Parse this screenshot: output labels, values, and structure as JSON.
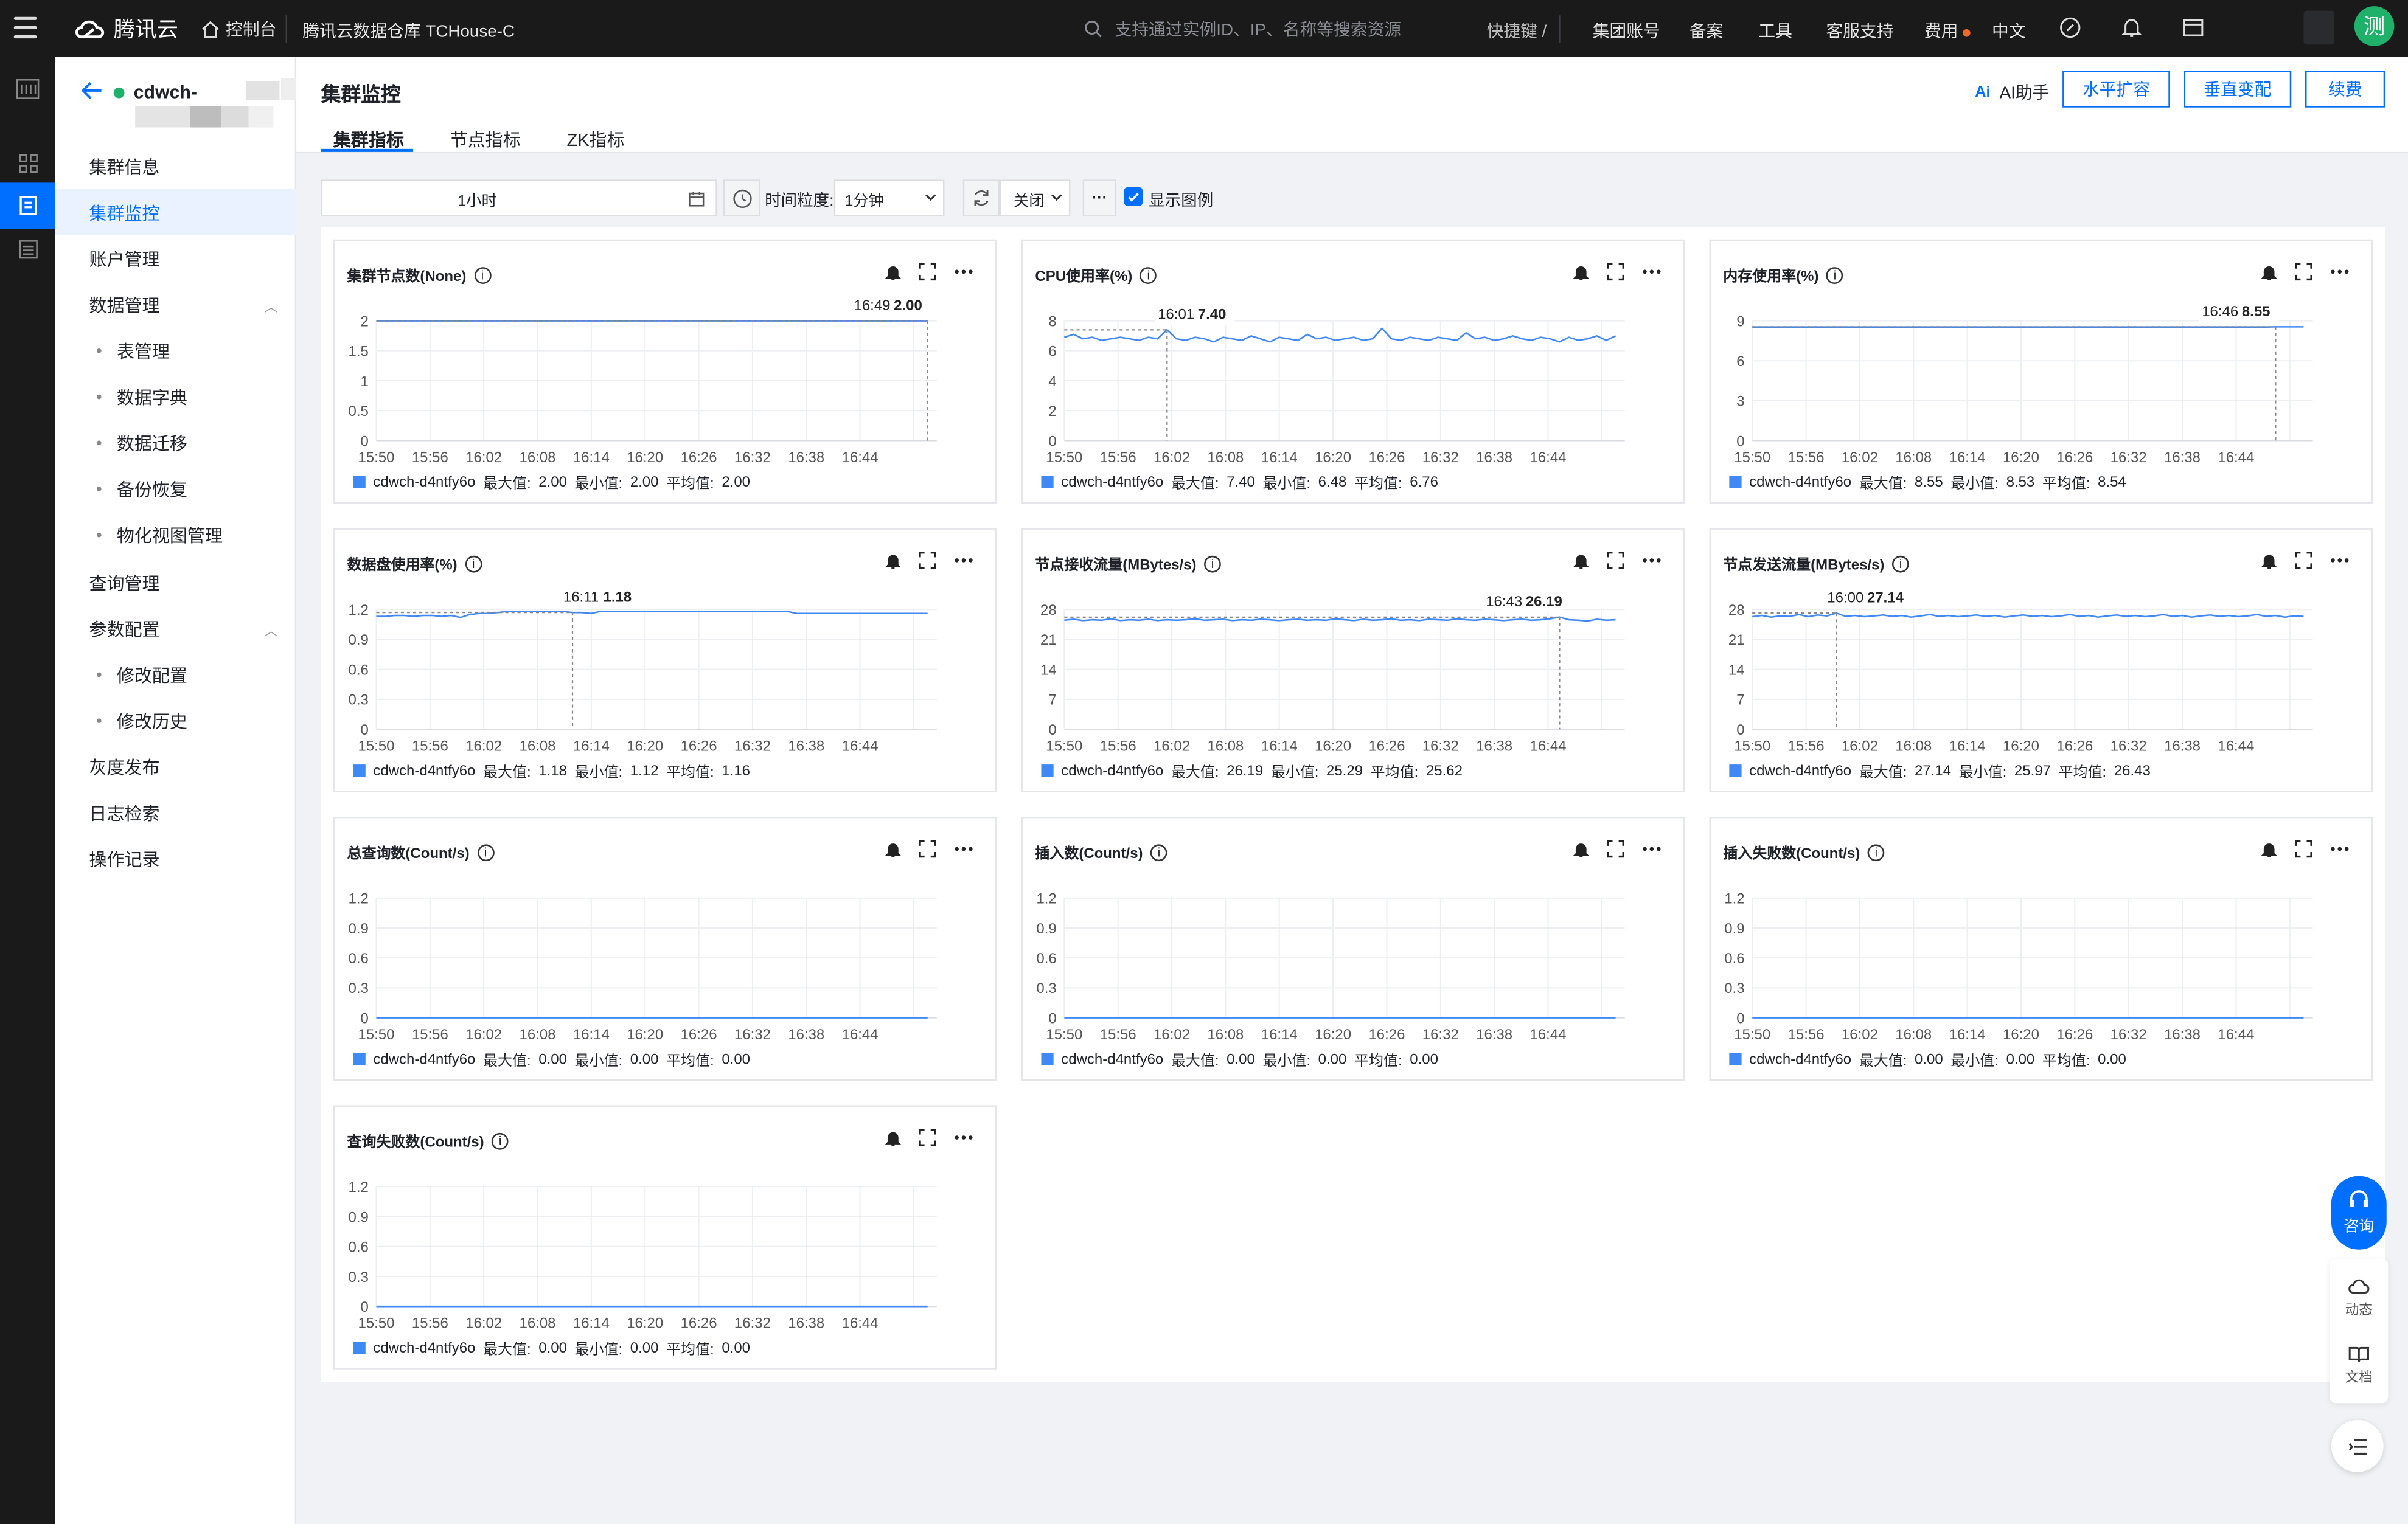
{
  "topbar": {
    "brand": "腾讯云",
    "console": "控制台",
    "product": "腾讯云数据仓库 TCHouse-C",
    "search_placeholder": "支持通过实例ID、IP、名称等搜索资源",
    "shortcut": "快捷键 /",
    "nav": [
      "集团账号",
      "备案",
      "工具",
      "客服支持",
      "费用",
      "中文"
    ],
    "avatar": "测"
  },
  "sidebar": {
    "cluster_name": "cdwch-",
    "items": [
      {
        "label": "集群信息"
      },
      {
        "label": "集群监控",
        "active": true
      },
      {
        "label": "账户管理"
      },
      {
        "label": "数据管理"
      },
      {
        "label": "表管理",
        "sub": true
      },
      {
        "label": "数据字典",
        "sub": true
      },
      {
        "label": "数据迁移",
        "sub": true
      },
      {
        "label": "备份恢复",
        "sub": true
      },
      {
        "label": "物化视图管理",
        "sub": true
      },
      {
        "label": "查询管理"
      },
      {
        "label": "参数配置"
      },
      {
        "label": "修改配置",
        "sub": true
      },
      {
        "label": "修改历史",
        "sub": true
      },
      {
        "label": "灰度发布"
      },
      {
        "label": "日志检索"
      },
      {
        "label": "操作记录"
      }
    ]
  },
  "page": {
    "title": "集群监控",
    "tabs": [
      "集群指标",
      "节点指标",
      "ZK指标"
    ],
    "ai_label": "AI助手",
    "ai_mark": "Ai",
    "buttons": [
      "水平扩容",
      "垂直变配",
      "续费"
    ]
  },
  "toolbar": {
    "time_range": "1小时",
    "granularity_label": "时间粒度:",
    "granularity_value": "1分钟",
    "refresh_value": "关闭",
    "show_legend": "显示图例",
    "more": "···"
  },
  "floating": {
    "consult": "咨询",
    "dynamic": "动态",
    "docs": "文档"
  },
  "legend_labels": {
    "max": "最大值:",
    "min": "最小值:",
    "avg": "平均值:"
  },
  "chart_data": [
    {
      "type": "line",
      "title": "集群节点数(None)",
      "series_name": "cdwch-d4ntfy6o",
      "x": [
        "15:50",
        "15:56",
        "16:02",
        "16:08",
        "16:14",
        "16:20",
        "16:26",
        "16:32",
        "16:38",
        "16:44"
      ],
      "yticks": [
        "2",
        "1.5",
        "1",
        "0.5",
        "0"
      ],
      "ylim": [
        0,
        2
      ],
      "values": [
        2,
        2,
        2,
        2,
        2,
        2,
        2,
        2,
        2,
        2,
        2,
        2,
        2,
        2,
        2,
        2,
        2,
        2,
        2,
        2,
        2,
        2,
        2,
        2,
        2,
        2,
        2,
        2,
        2,
        2,
        2,
        2,
        2,
        2,
        2,
        2,
        2,
        2,
        2,
        2,
        2,
        2,
        2,
        2,
        2,
        2,
        2,
        2,
        2,
        2,
        2,
        2,
        2,
        2,
        2,
        2,
        2,
        2,
        2,
        2
      ],
      "tooltip": {
        "time": "16:49",
        "value": "2.00",
        "index": 59
      },
      "stats": {
        "max": "2.00",
        "min": "2.00",
        "avg": "2.00"
      }
    },
    {
      "type": "line",
      "title": "CPU使用率(%)",
      "series_name": "cdwch-d4ntfy6o",
      "x": [
        "15:50",
        "15:56",
        "16:02",
        "16:08",
        "16:14",
        "16:20",
        "16:26",
        "16:32",
        "16:38",
        "16:44"
      ],
      "yticks": [
        "8",
        "6",
        "4",
        "2",
        "0"
      ],
      "ylim": [
        0,
        8
      ],
      "values": [
        6.9,
        7.1,
        6.8,
        6.9,
        6.7,
        6.8,
        6.9,
        6.8,
        6.7,
        6.9,
        6.8,
        7.4,
        6.8,
        6.7,
        6.9,
        6.8,
        6.6,
        6.9,
        6.8,
        6.7,
        7.0,
        6.8,
        6.6,
        6.9,
        6.8,
        6.7,
        7.1,
        6.8,
        6.9,
        6.7,
        6.8,
        6.9,
        6.7,
        6.8,
        7.5,
        6.8,
        6.7,
        6.9,
        6.8,
        6.7,
        6.9,
        6.8,
        6.7,
        7.2,
        6.8,
        6.9,
        6.7,
        6.8,
        7.0,
        6.8,
        6.7,
        6.9,
        6.8,
        6.6,
        6.9,
        6.7,
        6.8,
        7.0,
        6.7,
        7.0
      ],
      "tooltip": {
        "time": "16:01",
        "value": "7.40",
        "index": 11
      },
      "stats": {
        "max": "7.40",
        "min": "6.48",
        "avg": "6.76"
      }
    },
    {
      "type": "line",
      "title": "内存使用率(%)",
      "series_name": "cdwch-d4ntfy6o",
      "x": [
        "15:50",
        "15:56",
        "16:02",
        "16:08",
        "16:14",
        "16:20",
        "16:26",
        "16:32",
        "16:38",
        "16:44"
      ],
      "yticks": [
        "9",
        "6",
        "3",
        "0"
      ],
      "ylim": [
        0,
        9
      ],
      "values": [
        8.54,
        8.54,
        8.54,
        8.54,
        8.54,
        8.54,
        8.54,
        8.54,
        8.54,
        8.54,
        8.54,
        8.54,
        8.54,
        8.54,
        8.54,
        8.54,
        8.54,
        8.54,
        8.54,
        8.54,
        8.54,
        8.54,
        8.54,
        8.54,
        8.54,
        8.54,
        8.54,
        8.54,
        8.54,
        8.54,
        8.54,
        8.54,
        8.54,
        8.54,
        8.54,
        8.54,
        8.54,
        8.54,
        8.54,
        8.54,
        8.54,
        8.54,
        8.54,
        8.54,
        8.54,
        8.54,
        8.54,
        8.54,
        8.54,
        8.54,
        8.54,
        8.54,
        8.54,
        8.54,
        8.54,
        8.54,
        8.55,
        8.55,
        8.55,
        8.55
      ],
      "tooltip": {
        "time": "16:46",
        "value": "8.55",
        "index": 56
      },
      "stats": {
        "max": "8.55",
        "min": "8.53",
        "avg": "8.54"
      }
    },
    {
      "type": "line",
      "title": "数据盘使用率(%)",
      "series_name": "cdwch-d4ntfy6o",
      "x": [
        "15:50",
        "15:56",
        "16:02",
        "16:08",
        "16:14",
        "16:20",
        "16:26",
        "16:32",
        "16:38",
        "16:44"
      ],
      "yticks": [
        "1.2",
        "0.9",
        "0.6",
        "0.3",
        "0"
      ],
      "ylim": [
        0,
        1.2
      ],
      "values": [
        1.13,
        1.13,
        1.14,
        1.14,
        1.13,
        1.14,
        1.14,
        1.13,
        1.14,
        1.12,
        1.15,
        1.16,
        1.16,
        1.17,
        1.18,
        1.18,
        1.18,
        1.18,
        1.18,
        1.18,
        1.18,
        1.17,
        1.17,
        1.16,
        1.18,
        1.18,
        1.18,
        1.18,
        1.18,
        1.18,
        1.18,
        1.18,
        1.18,
        1.18,
        1.18,
        1.18,
        1.18,
        1.18,
        1.18,
        1.18,
        1.18,
        1.18,
        1.18,
        1.18,
        1.18,
        1.16,
        1.16,
        1.16,
        1.16,
        1.16,
        1.16,
        1.16,
        1.16,
        1.16,
        1.16,
        1.16,
        1.16,
        1.16,
        1.16,
        1.16
      ],
      "tooltip": {
        "time": "16:11",
        "value": "1.18",
        "index": 21
      },
      "stats": {
        "max": "1.18",
        "min": "1.12",
        "avg": "1.16"
      }
    },
    {
      "type": "line",
      "title": "节点接收流量(MBytes/s)",
      "series_name": "cdwch-d4ntfy6o",
      "x": [
        "15:50",
        "15:56",
        "16:02",
        "16:08",
        "16:14",
        "16:20",
        "16:26",
        "16:32",
        "16:38",
        "16:44"
      ],
      "yticks": [
        "28",
        "21",
        "14",
        "7",
        "0"
      ],
      "ylim": [
        0,
        28
      ],
      "values": [
        25.5,
        25.7,
        25.4,
        25.6,
        25.5,
        25.8,
        25.4,
        25.6,
        25.5,
        25.7,
        25.4,
        25.6,
        25.5,
        25.6,
        25.8,
        25.5,
        25.6,
        25.7,
        25.4,
        25.6,
        25.5,
        25.7,
        25.6,
        25.4,
        25.6,
        25.7,
        25.5,
        25.6,
        25.5,
        25.8,
        25.6,
        25.4,
        25.7,
        25.5,
        25.6,
        25.8,
        25.5,
        25.6,
        25.4,
        25.7,
        25.6,
        25.5,
        25.8,
        25.6,
        25.5,
        25.7,
        25.6,
        25.4,
        25.6,
        25.7,
        25.5,
        25.6,
        25.8,
        26.19,
        25.6,
        25.5,
        25.3,
        25.7,
        25.5,
        25.6
      ],
      "tooltip": {
        "time": "16:43",
        "value": "26.19",
        "index": 53
      },
      "stats": {
        "max": "26.19",
        "min": "25.29",
        "avg": "25.62"
      }
    },
    {
      "type": "line",
      "title": "节点发送流量(MBytes/s)",
      "series_name": "cdwch-d4ntfy6o",
      "x": [
        "15:50",
        "15:56",
        "16:02",
        "16:08",
        "16:14",
        "16:20",
        "16:26",
        "16:32",
        "16:38",
        "16:44"
      ],
      "yticks": [
        "28",
        "21",
        "14",
        "7",
        "0"
      ],
      "ylim": [
        0,
        28
      ],
      "values": [
        26.3,
        26.6,
        26.2,
        26.5,
        26.4,
        26.8,
        26.3,
        26.7,
        26.5,
        27.14,
        26.4,
        26.6,
        26.3,
        26.5,
        26.7,
        26.4,
        26.6,
        26.2,
        26.5,
        26.8,
        26.4,
        26.6,
        26.3,
        26.5,
        26.7,
        26.4,
        26.6,
        26.2,
        26.5,
        26.7,
        26.4,
        26.6,
        26.3,
        26.5,
        26.8,
        26.4,
        26.6,
        26.2,
        26.5,
        26.7,
        26.4,
        26.6,
        26.3,
        26.5,
        26.8,
        26.4,
        26.6,
        26.2,
        26.5,
        26.7,
        26.4,
        26.6,
        26.3,
        26.5,
        26.8,
        26.4,
        26.6,
        26.2,
        26.5,
        26.4
      ],
      "tooltip": {
        "time": "16:00",
        "value": "27.14",
        "index": 9
      },
      "stats": {
        "max": "27.14",
        "min": "25.97",
        "avg": "26.43"
      }
    },
    {
      "type": "line",
      "title": "总查询数(Count/s)",
      "series_name": "cdwch-d4ntfy6o",
      "x": [
        "15:50",
        "15:56",
        "16:02",
        "16:08",
        "16:14",
        "16:20",
        "16:26",
        "16:32",
        "16:38",
        "16:44"
      ],
      "yticks": [
        "1.2",
        "0.9",
        "0.6",
        "0.3",
        "0"
      ],
      "ylim": [
        0,
        1.2
      ],
      "values": [
        0,
        0,
        0,
        0,
        0,
        0,
        0,
        0,
        0,
        0,
        0,
        0,
        0,
        0,
        0,
        0,
        0,
        0,
        0,
        0,
        0,
        0,
        0,
        0,
        0,
        0,
        0,
        0,
        0,
        0,
        0,
        0,
        0,
        0,
        0,
        0,
        0,
        0,
        0,
        0,
        0,
        0,
        0,
        0,
        0,
        0,
        0,
        0,
        0,
        0,
        0,
        0,
        0,
        0,
        0,
        0,
        0,
        0,
        0,
        0
      ],
      "stats": {
        "max": "0.00",
        "min": "0.00",
        "avg": "0.00"
      }
    },
    {
      "type": "line",
      "title": "插入数(Count/s)",
      "series_name": "cdwch-d4ntfy6o",
      "x": [
        "15:50",
        "15:56",
        "16:02",
        "16:08",
        "16:14",
        "16:20",
        "16:26",
        "16:32",
        "16:38",
        "16:44"
      ],
      "yticks": [
        "1.2",
        "0.9",
        "0.6",
        "0.3",
        "0"
      ],
      "ylim": [
        0,
        1.2
      ],
      "values": [
        0,
        0,
        0,
        0,
        0,
        0,
        0,
        0,
        0,
        0,
        0,
        0,
        0,
        0,
        0,
        0,
        0,
        0,
        0,
        0,
        0,
        0,
        0,
        0,
        0,
        0,
        0,
        0,
        0,
        0,
        0,
        0,
        0,
        0,
        0,
        0,
        0,
        0,
        0,
        0,
        0,
        0,
        0,
        0,
        0,
        0,
        0,
        0,
        0,
        0,
        0,
        0,
        0,
        0,
        0,
        0,
        0,
        0,
        0,
        0
      ],
      "stats": {
        "max": "0.00",
        "min": "0.00",
        "avg": "0.00"
      }
    },
    {
      "type": "line",
      "title": "插入失败数(Count/s)",
      "series_name": "cdwch-d4ntfy6o",
      "x": [
        "15:50",
        "15:56",
        "16:02",
        "16:08",
        "16:14",
        "16:20",
        "16:26",
        "16:32",
        "16:38",
        "16:44"
      ],
      "yticks": [
        "1.2",
        "0.9",
        "0.6",
        "0.3",
        "0"
      ],
      "ylim": [
        0,
        1.2
      ],
      "values": [
        0,
        0,
        0,
        0,
        0,
        0,
        0,
        0,
        0,
        0,
        0,
        0,
        0,
        0,
        0,
        0,
        0,
        0,
        0,
        0,
        0,
        0,
        0,
        0,
        0,
        0,
        0,
        0,
        0,
        0,
        0,
        0,
        0,
        0,
        0,
        0,
        0,
        0,
        0,
        0,
        0,
        0,
        0,
        0,
        0,
        0,
        0,
        0,
        0,
        0,
        0,
        0,
        0,
        0,
        0,
        0,
        0,
        0,
        0,
        0
      ],
      "stats": {
        "max": "0.00",
        "min": "0.00",
        "avg": "0.00"
      }
    },
    {
      "type": "line",
      "title": "查询失败数(Count/s)",
      "series_name": "cdwch-d4ntfy6o",
      "x": [
        "15:50",
        "15:56",
        "16:02",
        "16:08",
        "16:14",
        "16:20",
        "16:26",
        "16:32",
        "16:38",
        "16:44"
      ],
      "yticks": [
        "1.2",
        "0.9",
        "0.6",
        "0.3",
        "0"
      ],
      "ylim": [
        0,
        1.2
      ],
      "values": [
        0,
        0,
        0,
        0,
        0,
        0,
        0,
        0,
        0,
        0,
        0,
        0,
        0,
        0,
        0,
        0,
        0,
        0,
        0,
        0,
        0,
        0,
        0,
        0,
        0,
        0,
        0,
        0,
        0,
        0,
        0,
        0,
        0,
        0,
        0,
        0,
        0,
        0,
        0,
        0,
        0,
        0,
        0,
        0,
        0,
        0,
        0,
        0,
        0,
        0,
        0,
        0,
        0,
        0,
        0,
        0,
        0,
        0,
        0,
        0
      ],
      "stats": {
        "max": "0.00",
        "min": "0.00",
        "avg": "0.00"
      }
    }
  ]
}
